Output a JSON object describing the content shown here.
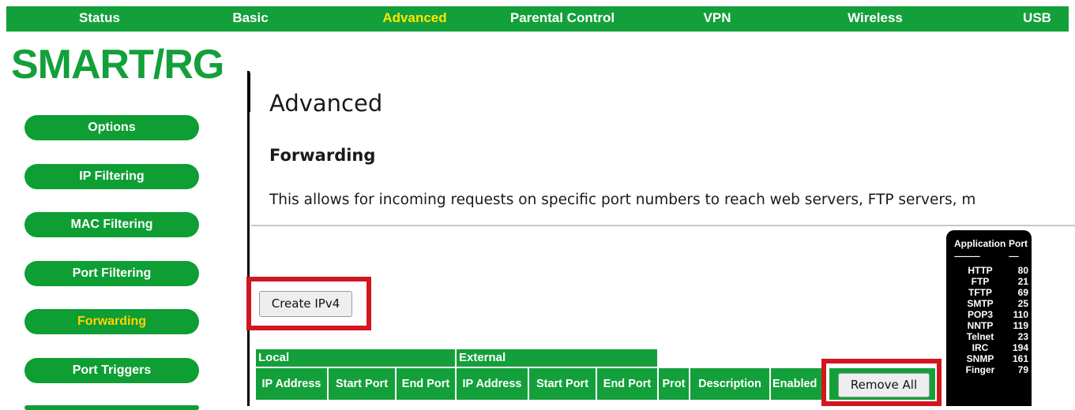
{
  "topnav": [
    {
      "label": "Status",
      "active": false
    },
    {
      "label": "Basic",
      "active": false
    },
    {
      "label": "Advanced",
      "active": true
    },
    {
      "label": "Parental Control",
      "active": false
    },
    {
      "label": "VPN",
      "active": false
    },
    {
      "label": "Wireless",
      "active": false
    },
    {
      "label": "USB",
      "active": false
    }
  ],
  "logo": {
    "text": "SMART/RG"
  },
  "sidebar": [
    {
      "label": "Options",
      "active": false
    },
    {
      "label": "IP Filtering",
      "active": false
    },
    {
      "label": "MAC Filtering",
      "active": false
    },
    {
      "label": "Port Filtering",
      "active": false
    },
    {
      "label": "Forwarding",
      "active": true
    },
    {
      "label": "Port Triggers",
      "active": false
    }
  ],
  "page": {
    "title": "Advanced",
    "subtitle": "Forwarding",
    "description": "This allows for incoming requests on specific port numbers to reach web servers, FTP servers, m"
  },
  "buttons": {
    "create_ipv4": "Create IPv4",
    "remove_all": "Remove All"
  },
  "table": {
    "groups": [
      "Local",
      "External"
    ],
    "columns": [
      "IP Address",
      "Start Port",
      "End Port",
      "IP Address",
      "Start Port",
      "End Port",
      "Prot",
      "Description",
      "Enabled"
    ]
  },
  "port_legend": {
    "headers": [
      "Application",
      "Port"
    ],
    "separator": [
      "----------------",
      "------"
    ],
    "rows": [
      {
        "app": "HTTP",
        "port": "80"
      },
      {
        "app": "FTP",
        "port": "21"
      },
      {
        "app": "TFTP",
        "port": "69"
      },
      {
        "app": "SMTP",
        "port": "25"
      },
      {
        "app": "POP3",
        "port": "110"
      },
      {
        "app": "NNTP",
        "port": "119"
      },
      {
        "app": "Telnet",
        "port": "23"
      },
      {
        "app": "IRC",
        "port": "194"
      },
      {
        "app": "SNMP",
        "port": "161"
      },
      {
        "app": "Finger",
        "port": "79"
      }
    ]
  },
  "colors": {
    "brand_green": "#13a03a",
    "active_text": "#ffe600",
    "highlight_red": "#d1161e"
  }
}
